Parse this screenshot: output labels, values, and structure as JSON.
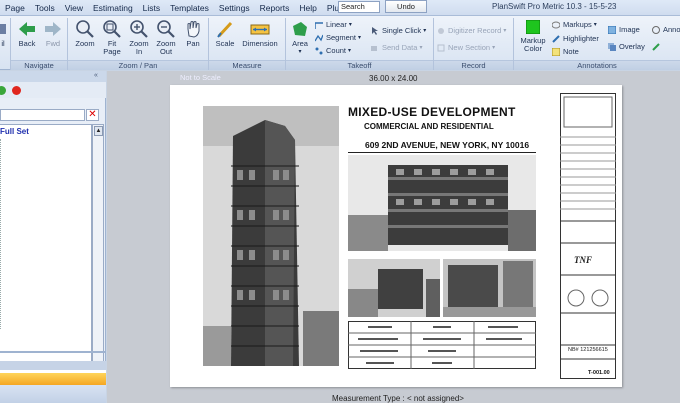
{
  "menu": [
    "Page",
    "Tools",
    "View",
    "Estimating",
    "Lists",
    "Templates",
    "Settings",
    "Reports",
    "Help",
    "Plugins"
  ],
  "search": {
    "value": "Search"
  },
  "undo_label": "Undo",
  "app_title": "PlanSwift Pro Metric 10.3 - 15-5-23",
  "ribbon": {
    "navigate": {
      "label": "Navigate",
      "back": "Back",
      "fwd": "Fwd"
    },
    "zoom_pan": {
      "label": "Zoom / Pan",
      "zoom": "Zoom",
      "fit_page_1": "Fit",
      "fit_page_2": "Page",
      "zoom_in_1": "Zoom",
      "zoom_in_2": "In",
      "zoom_out_1": "Zoom",
      "zoom_out_2": "Out",
      "pan": "Pan"
    },
    "measure": {
      "label": "Measure",
      "scale": "Scale",
      "dimension": "Dimension"
    },
    "takeoff": {
      "label": "Takeoff",
      "area": "Area",
      "linear": "Linear",
      "segment": "Segment",
      "count": "Count",
      "single_click": "Single Click",
      "send_data": "Send Data"
    },
    "record": {
      "label": "Record",
      "digitizer": "Digitizer Record",
      "new_section": "New Section"
    },
    "annotations": {
      "label": "Annotations",
      "markup_color_1": "Markup",
      "markup_color_2": "Color",
      "markups": "Markups",
      "highlighter": "Highlighter",
      "note": "Note",
      "image": "Image",
      "overlay": "Overlay",
      "anno": "Anno"
    },
    "partial_left": "il"
  },
  "left_panel": {
    "tree_root": "Full Set",
    "collapse_glyph": "«"
  },
  "canvas": {
    "not_to_scale": "Not to Scale",
    "page_size": "36.00 x 24.00",
    "measurement_type": "Measurement Type : < not assigned>"
  },
  "sheet": {
    "title": "MIXED-USE DEVELOPMENT",
    "subtitle": "COMMERCIAL AND RESIDENTIAL",
    "address": "609 2ND AVENUE, NEW YORK, NY 10016",
    "sheet_number": "T-001.00",
    "nb": "NB# 121256615"
  },
  "colors": {
    "accent_green": "#1ec51e",
    "remove_red": "#e0261e",
    "add_green": "#3aa63a"
  }
}
